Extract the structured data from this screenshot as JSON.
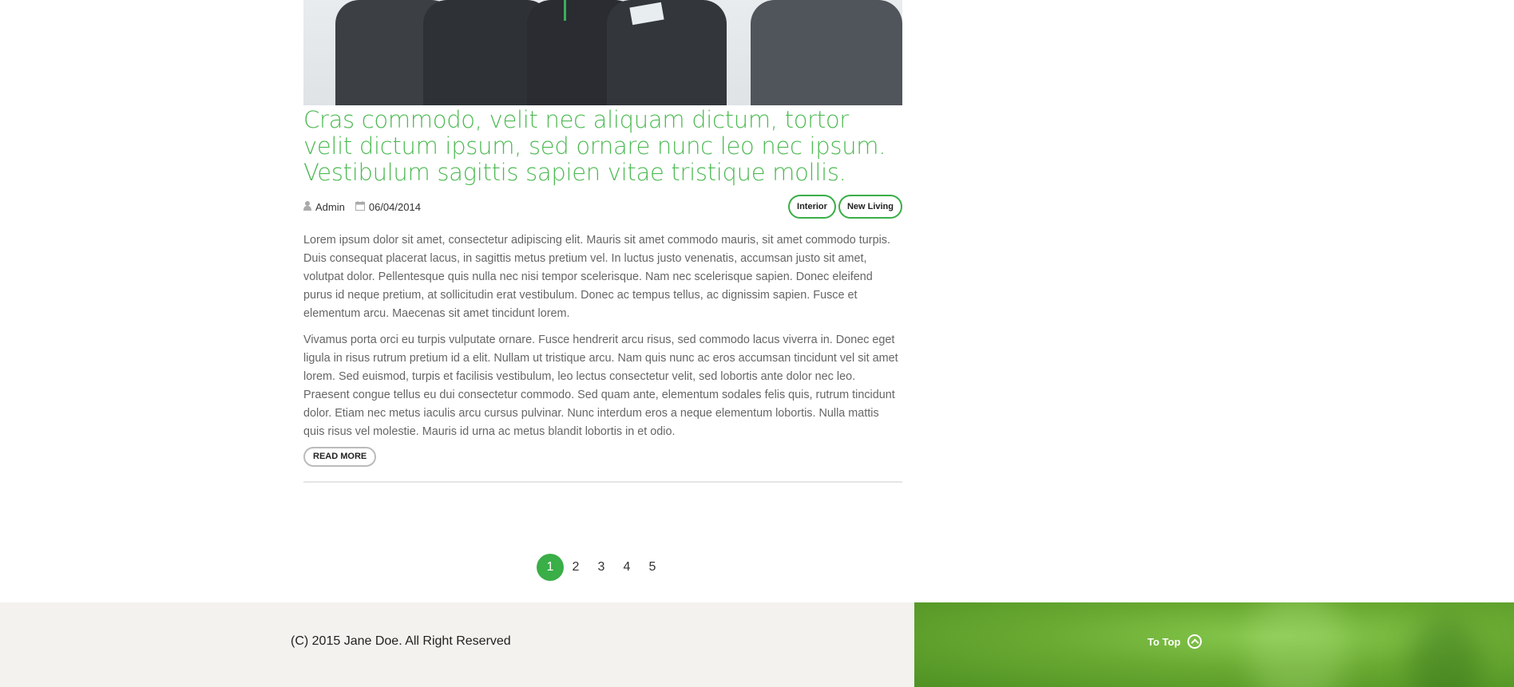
{
  "post": {
    "title": "Cras commodo, velit nec aliquam dictum, tortor velit dictum ipsum, sed ornare nunc leo nec ipsum. Vestibulum sagittis sapien vitae tristique mollis.",
    "author": "Admin",
    "date": "06/04/2014",
    "author_icon": "user-icon",
    "date_icon": "calendar-icon",
    "tags": [
      "Interior",
      "New Living"
    ],
    "paragraphs": [
      "Lorem ipsum dolor sit amet, consectetur adipiscing elit. Mauris sit amet commodo mauris, sit amet commodo turpis. Duis consequat placerat lacus, in sagittis metus pretium vel. In luctus justo venenatis, accumsan justo sit amet, volutpat dolor. Pellentesque quis nulla nec nisi tempor scelerisque. Nam nec scelerisque sapien. Donec eleifend purus id neque pretium, at sollicitudin erat vestibulum. Donec ac tempus tellus, ac dignissim sapien. Fusce et elementum arcu. Maecenas sit amet tincidunt lorem.",
      "Vivamus porta orci eu turpis vulputate ornare. Fusce hendrerit arcu risus, sed commodo lacus viverra in. Donec eget ligula in risus rutrum pretium id a elit. Nullam ut tristique arcu. Nam quis nunc ac eros accumsan tincidunt vel sit amet lorem. Sed euismod, turpis et facilisis vestibulum, leo lectus consectetur velit, sed lobortis ante dolor nec leo. Praesent congue tellus eu dui consectetur commodo. Sed quam ante, elementum sodales felis quis, rutrum tincidunt dolor. Etiam nec metus iaculis arcu cursus pulvinar. Nunc interdum eros a neque elementum lobortis. Nulla mattis quis risus vel molestie. Mauris id urna ac metus blandit lobortis in et odio."
    ],
    "read_more_label": "READ MORE"
  },
  "pagination": {
    "pages": [
      "1",
      "2",
      "3",
      "4",
      "5"
    ],
    "current": "1"
  },
  "footer": {
    "copyright": "(C) 2015 Jane Doe. All Right Reserved",
    "to_top_label": "To Top",
    "to_top_icon": "chevron-up-circle-icon"
  },
  "colors": {
    "accent": "#3aae47",
    "title": "#4cba52",
    "footer_bg": "#f3f2ee",
    "footer_green": "#6aaa32"
  }
}
